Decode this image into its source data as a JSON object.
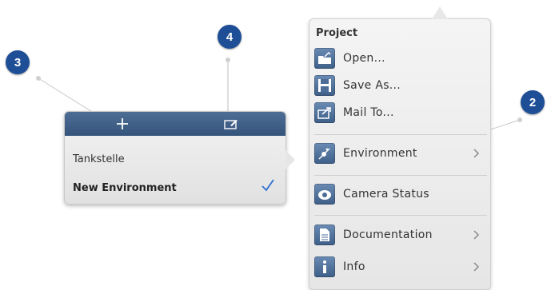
{
  "environment_popover": {
    "toolbar": {
      "add_icon": "plus-icon",
      "edit_icon": "edit-icon"
    },
    "items": [
      {
        "label": "Tankstelle",
        "selected": false
      },
      {
        "label": "New Environment",
        "selected": true
      }
    ],
    "checkmark_icon": "checkmark-icon"
  },
  "menu": {
    "title": "Project",
    "items": [
      {
        "label": "Open...",
        "icon": "open-folder-icon"
      },
      {
        "label": "Save As...",
        "icon": "save-disk-icon"
      },
      {
        "label": "Mail To...",
        "icon": "mail-share-icon"
      },
      {
        "label": "Environment",
        "icon": "environment-icon",
        "chevron": true
      },
      {
        "label": "Camera Status",
        "icon": "camera-icon"
      },
      {
        "label": "Documentation",
        "icon": "document-icon",
        "chevron": true
      },
      {
        "label": "Info",
        "icon": "info-icon",
        "chevron": true
      }
    ]
  },
  "callouts": {
    "badge_3": "3",
    "badge_4": "4",
    "badge_2": "2"
  },
  "colors": {
    "toolbar": "#3d5f88",
    "badge": "#1e4f96",
    "checkmark": "#2f6fd0"
  }
}
